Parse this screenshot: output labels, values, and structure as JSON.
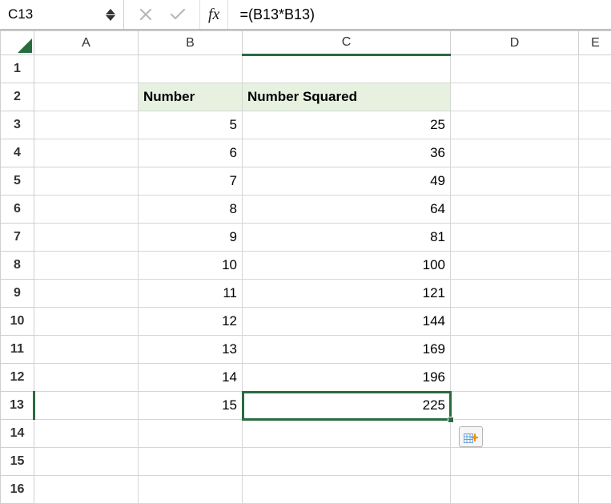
{
  "nameBox": {
    "value": "C13"
  },
  "formulaBar": {
    "fxLabel": "fx",
    "formula": "=(B13*B13)"
  },
  "columns": [
    "A",
    "B",
    "C",
    "D",
    "E"
  ],
  "rowCount": 16,
  "headers": {
    "b2": "Number",
    "c2": "Number Squared"
  },
  "data": {
    "B": {
      "3": "5",
      "4": "6",
      "5": "7",
      "6": "8",
      "7": "9",
      "8": "10",
      "9": "11",
      "10": "12",
      "11": "13",
      "12": "14",
      "13": "15"
    },
    "C": {
      "3": "25",
      "4": "36",
      "5": "49",
      "6": "64",
      "7": "81",
      "8": "100",
      "9": "121",
      "10": "144",
      "11": "169",
      "12": "196",
      "13": "225"
    }
  },
  "selection": {
    "col": "C",
    "row": 13
  },
  "chart_data": {
    "type": "table",
    "title": "Number Squared",
    "columns": [
      "Number",
      "Number Squared"
    ],
    "rows": [
      [
        5,
        25
      ],
      [
        6,
        36
      ],
      [
        7,
        49
      ],
      [
        8,
        64
      ],
      [
        9,
        81
      ],
      [
        10,
        100
      ],
      [
        11,
        121
      ],
      [
        12,
        144
      ],
      [
        13,
        169
      ],
      [
        14,
        196
      ],
      [
        15,
        225
      ]
    ]
  }
}
